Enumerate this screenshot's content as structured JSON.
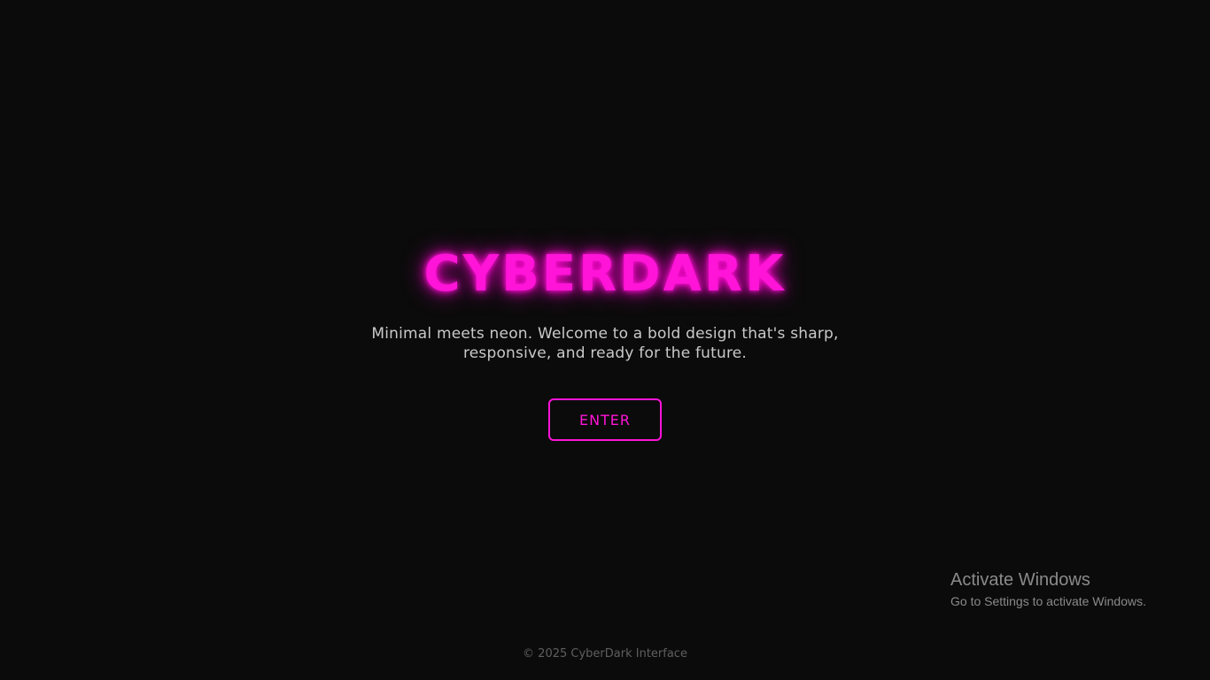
{
  "hero": {
    "title": "CYBERDARK",
    "tagline": "Minimal meets neon. Welcome to a bold design that's sharp, responsive, and ready for the future.",
    "button_label": "ENTER"
  },
  "footer": {
    "text": "© 2025 CyberDark Interface"
  },
  "activation": {
    "title": "Activate Windows",
    "subtitle": "Go to Settings to activate Windows."
  },
  "colors": {
    "background": "#0b0b0b",
    "accent": "#ff14d8",
    "tagline": "#c9c9c9",
    "footer": "#5f5f5f"
  }
}
